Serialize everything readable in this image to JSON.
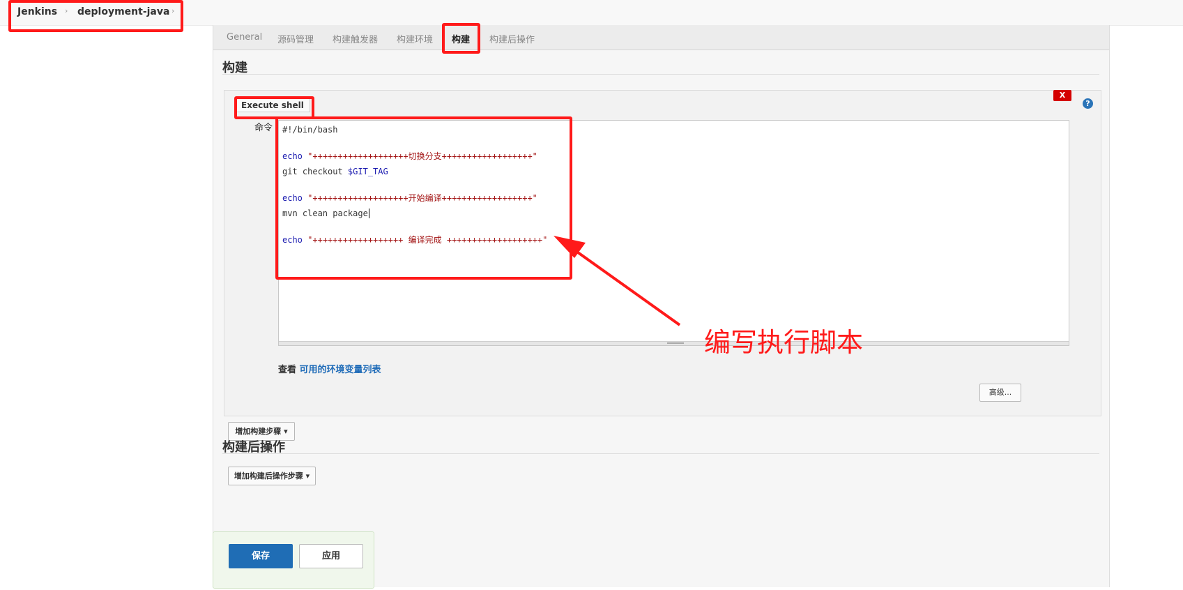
{
  "breadcrumb": {
    "items": [
      "Jenkins",
      "deployment-java"
    ],
    "separator": "›"
  },
  "tabs": [
    "General",
    "源码管理",
    "构建触发器",
    "构建环境",
    "构建",
    "构建后操作"
  ],
  "active_tab": "构建",
  "build_section": {
    "title": "构建",
    "step": {
      "name": "Execute shell",
      "delete_label": "X",
      "help_label": "?",
      "command_label": "命令",
      "code": {
        "line1": "#!/bin/bash",
        "echo_kw": "echo",
        "echo1_str": "\"+++++++++++++++++++切换分支++++++++++++++++++\"",
        "git_cmd": "git checkout ",
        "git_var": "$GIT_TAG",
        "echo2_str": "\"+++++++++++++++++++开始编译++++++++++++++++++\"",
        "mvn_cmd": "mvn clean package",
        "echo3_str": "\"++++++++++++++++++ 编译完成 +++++++++++++++++++\""
      },
      "env_prefix": "查看 ",
      "env_link": "可用的环境变量列表",
      "advanced_button": "高级..."
    },
    "add_step_button": "增加构建步骤 ▾"
  },
  "post_build_section": {
    "title": "构建后操作",
    "add_step_button": "增加构建后操作步骤 ▾"
  },
  "actions": {
    "save": "保存",
    "apply": "应用"
  },
  "annotation": {
    "text": "编写执行脚本",
    "color": "#ff1a1a"
  },
  "colors": {
    "primary_button": "#1f6db5",
    "link": "#1e6bb8",
    "delete": "#d40000"
  }
}
